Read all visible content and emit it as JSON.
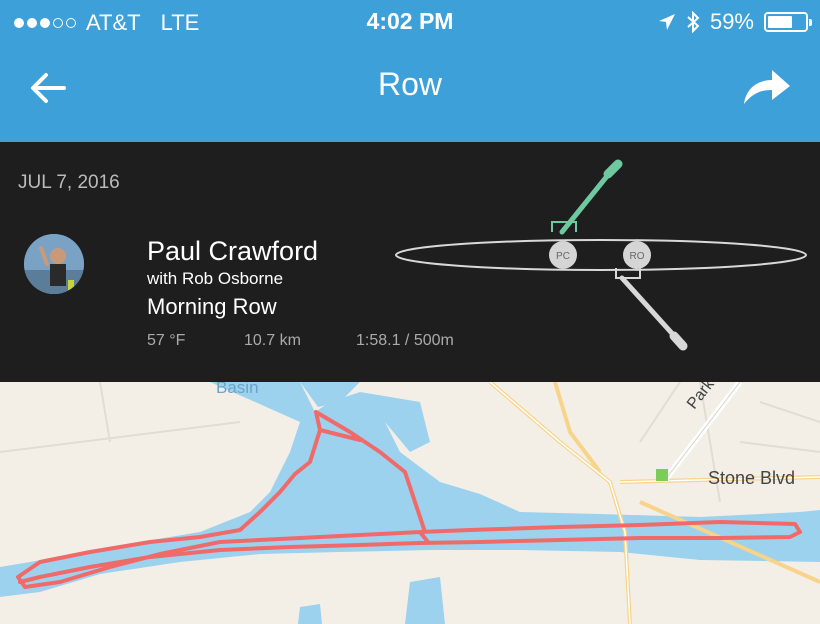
{
  "status_bar": {
    "carrier": "AT&T",
    "network": "LTE",
    "time": "4:02 PM",
    "battery_text": "59%",
    "battery_level": 0.59,
    "signal_bars": 3,
    "signal_max": 5
  },
  "nav": {
    "title": "Row",
    "back_icon": "arrow-left-icon",
    "share_icon": "share-arrow-icon"
  },
  "session": {
    "date": "JUL 7, 2016",
    "athlete_name": "Paul Crawford",
    "partner": "with Rob Osborne",
    "workout_name": "Morning Row",
    "temperature": "57 °F",
    "distance": "10.7 km",
    "pace": "1:58.1 / 500m"
  },
  "boat": {
    "seats": [
      {
        "initials": "PC",
        "side": "port"
      },
      {
        "initials": "RO",
        "side": "starboard"
      }
    ],
    "port_oar_color": "#6fc9a0",
    "starboard_oar_color": "#d8d8d8"
  },
  "map": {
    "labels": {
      "basin": "Basin",
      "park": "Park Bl",
      "stone": "Stone Blvd"
    },
    "water_color": "#9cd2ee",
    "land_color": "#f3efe7",
    "route_color": "#f06a6a"
  },
  "colors": {
    "accent": "#3da0d8",
    "panel": "#1e1e1e"
  }
}
